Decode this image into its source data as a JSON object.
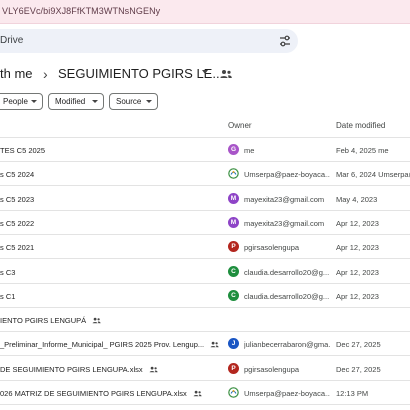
{
  "browser": {
    "url_fragment": "VLY6EVc/bi9XJ8FfKTM3WTNsNGENy"
  },
  "search": {
    "text": "Drive"
  },
  "breadcrumb": {
    "parent": "th me",
    "current": "SEGUIMIENTO PGIRS LE..."
  },
  "filters": [
    {
      "label": "People"
    },
    {
      "label": "Modified"
    },
    {
      "label": "Source"
    }
  ],
  "columns": {
    "owner": "Owner",
    "date": "Date modified"
  },
  "rows": [
    {
      "name": "TES C5 2025",
      "shared": false,
      "owner": "me",
      "avatar_letter": "G",
      "avatar_color": "#a855c8",
      "avatar_kind": "letter",
      "date": "Feb 4, 2025 me"
    },
    {
      "name": "s C5 2024",
      "shared": false,
      "owner": "Umserpa@paez-boyaca...",
      "avatar_letter": "",
      "avatar_color": "#ffffff",
      "avatar_kind": "logo",
      "date": "Mar 6, 2024 Umserpa@p"
    },
    {
      "name": "s C5 2023",
      "shared": false,
      "owner": "mayexita23@gmail.com",
      "avatar_letter": "M",
      "avatar_color": "#8e44c7",
      "avatar_kind": "letter",
      "date": "May 4, 2023"
    },
    {
      "name": "s C5 2022",
      "shared": false,
      "owner": "mayexita23@gmail.com",
      "avatar_letter": "M",
      "avatar_color": "#8e44c7",
      "avatar_kind": "letter",
      "date": "Apr 12, 2023"
    },
    {
      "name": "s C5 2021",
      "shared": false,
      "owner": "pgirsasolengupa",
      "avatar_letter": "P",
      "avatar_color": "#b3261e",
      "avatar_kind": "letter",
      "date": "Apr 12, 2023"
    },
    {
      "name": "s C3",
      "shared": false,
      "owner": "claudia.desarrollo20@g...",
      "avatar_letter": "C",
      "avatar_color": "#1e8e3e",
      "avatar_kind": "letter",
      "date": "Apr 12, 2023"
    },
    {
      "name": "s C1",
      "shared": false,
      "owner": "claudia.desarrollo20@g...",
      "avatar_letter": "C",
      "avatar_color": "#1e8e3e",
      "avatar_kind": "letter",
      "date": "Apr 12, 2023"
    },
    {
      "name": "IENTO PGIRS LENGUPÁ",
      "shared": true,
      "owner": "",
      "avatar_letter": "",
      "avatar_color": "",
      "avatar_kind": "none",
      "date": ""
    },
    {
      "name": "_Preliminar_Informe_Municipal_ PGIRS 2025 Prov. Lengup...",
      "shared": true,
      "owner": "julianbecerrabaron@gma...",
      "avatar_letter": "J",
      "avatar_color": "#1a56c4",
      "avatar_kind": "letter",
      "date": "Dec 27, 2025"
    },
    {
      "name": "DE SEGUIMIENTO PGIRS LENGUPA.xlsx",
      "shared": true,
      "owner": "pgirsasolengupa",
      "avatar_letter": "P",
      "avatar_color": "#b3261e",
      "avatar_kind": "letter",
      "date": "Dec 27, 2025"
    },
    {
      "name": "026 MATRIZ DE SEGUIMIENTO PGIRS LENGUPA.xlsx",
      "shared": true,
      "owner": "Umserpa@paez-boyaca...",
      "avatar_letter": "",
      "avatar_color": "#ffffff",
      "avatar_kind": "logo",
      "date": "12:13 PM"
    }
  ]
}
